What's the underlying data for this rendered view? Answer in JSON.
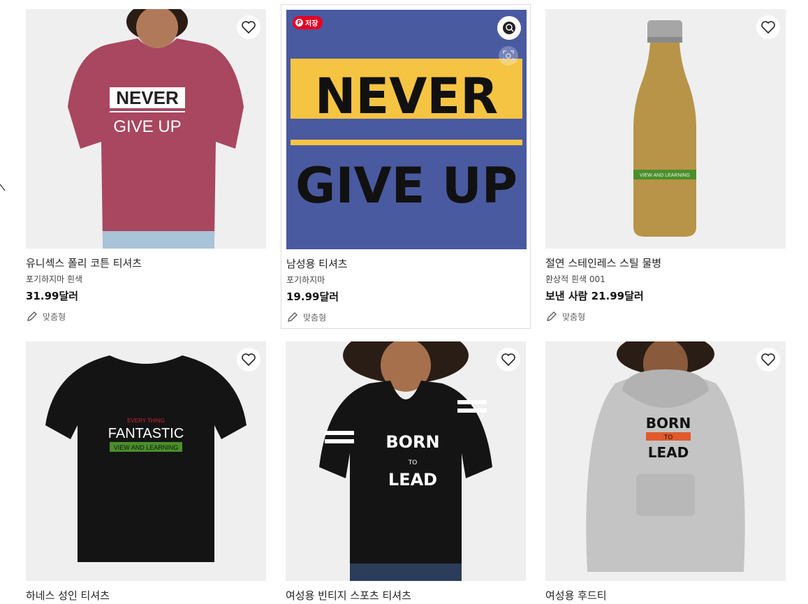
{
  "products": [
    {
      "title": "유니섹스 폴리 코튼 티셔츠",
      "subtitle": "포기하지마 흰색",
      "price": "31.99달러",
      "custom": "맞춤형",
      "design": [
        "NEVER",
        "GIVE UP"
      ],
      "garment_color": "#a8475f"
    },
    {
      "title": "남성용 티셔츠",
      "subtitle": "포기하지마",
      "price": "19.99달러",
      "custom": "맞춤형",
      "design": [
        "NEVER",
        "GIVE UP"
      ],
      "pin_label": "저장"
    },
    {
      "title": "절연 스테인레스 스틸 물병",
      "subtitle": "환상적 흰색 001",
      "price": "보낸 사람 21.99달러",
      "custom": "맞춤형",
      "design": [
        "VIEW AND LEARNING"
      ]
    },
    {
      "title": "하네스 성인 티셔츠",
      "design": [
        "EVERY THING",
        "FANTASTIC",
        "VIEW AND LEARNING"
      ]
    },
    {
      "title": "여성용 빈티지 스포츠 티셔츠",
      "design": [
        "BORN",
        "TO",
        "LEAD"
      ]
    },
    {
      "title": "여성용 후드티",
      "design": [
        "BORN",
        "TO",
        "LEAD"
      ]
    }
  ],
  "colors": {
    "pinterest": "#e60023",
    "tile_bg": "#f2f2f2",
    "poster_blue": "#4a5aa0",
    "poster_yellow": "#f6c443",
    "accent_orange": "#e05a2b",
    "accent_green": "#4a8f2a"
  }
}
